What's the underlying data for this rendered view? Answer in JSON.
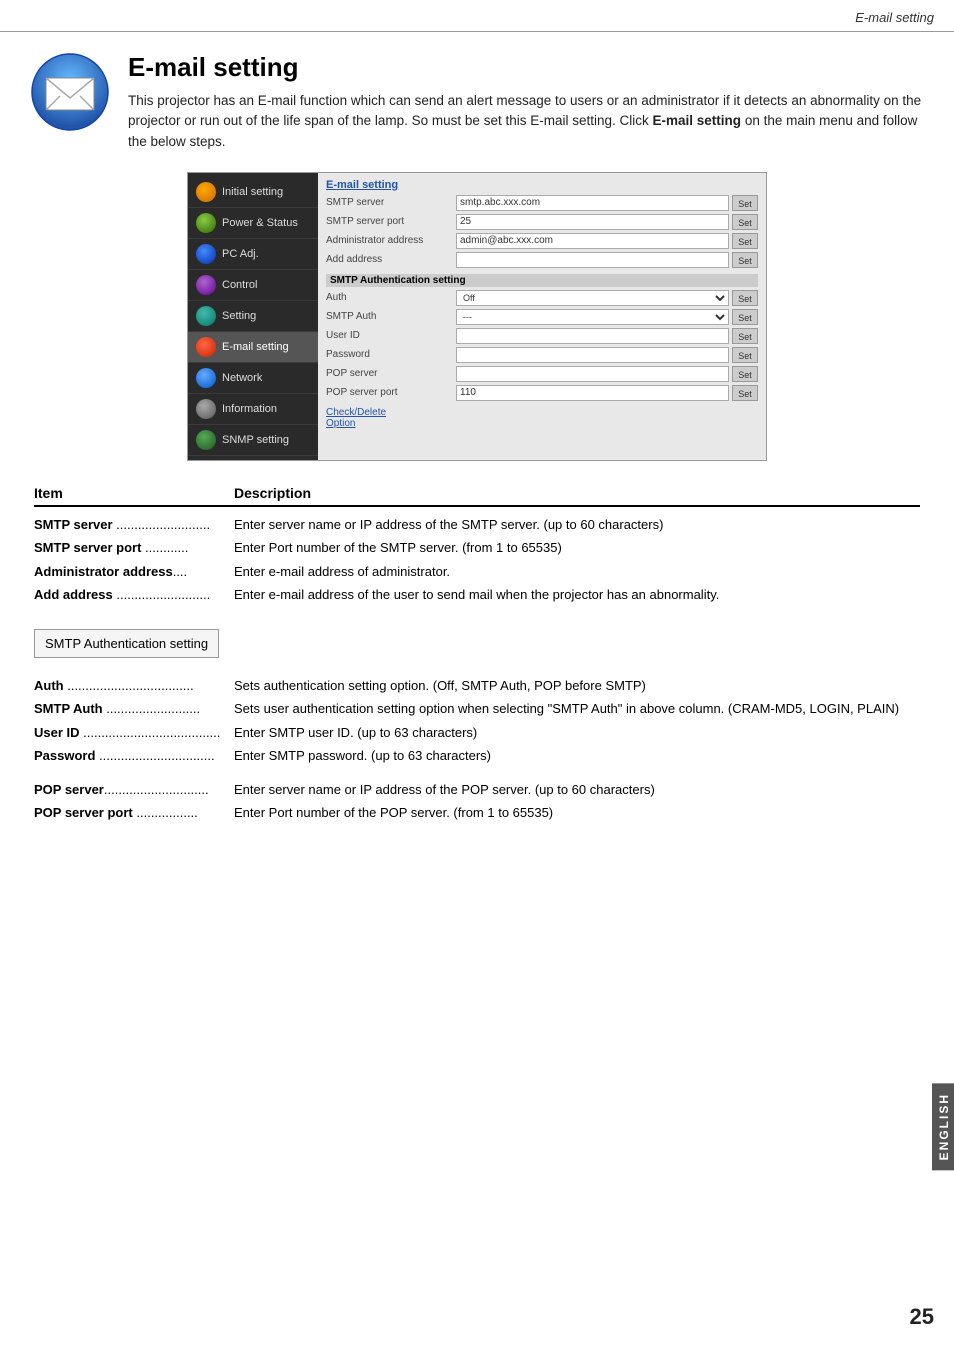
{
  "page": {
    "header": "E-mail setting",
    "page_number": "25",
    "english_tab": "ENGLISH"
  },
  "title_section": {
    "heading": "E-mail setting",
    "description": "This projector has an E-mail function which can send an alert message to users or an administrator if it detects an abnormality on the projector or run out of the life span of the lamp. So must be set this E-mail setting.",
    "click_text": "Click",
    "bold_part": "E-mail setting",
    "end_text": "on the main menu and follow the below steps."
  },
  "ui_panel": {
    "sidebar_items": [
      {
        "label": "Initial setting",
        "icon_class": "orange"
      },
      {
        "label": "Power & Status",
        "icon_class": "green"
      },
      {
        "label": "PC Adj.",
        "icon_class": "blue"
      },
      {
        "label": "Control",
        "icon_class": "purple"
      },
      {
        "label": "Setting",
        "icon_class": "teal"
      },
      {
        "label": "E-mail setting",
        "icon_class": "red",
        "active": true
      },
      {
        "label": "Network",
        "icon_class": "lightblue"
      },
      {
        "label": "Information",
        "icon_class": "gray"
      },
      {
        "label": "SNMP setting",
        "icon_class": "darkgreen"
      }
    ],
    "main": {
      "section_title": "E-mail setting",
      "fields": [
        {
          "label": "SMTP server",
          "value": "smtp.abc.xxx.com",
          "btn": "Set"
        },
        {
          "label": "SMTP server port",
          "value": "25",
          "btn": "Set"
        },
        {
          "label": "Administrator address",
          "value": "admin@abc.xxx.com",
          "btn": "Set"
        },
        {
          "label": "Add address",
          "value": "",
          "btn": "Set"
        }
      ],
      "smtp_auth": {
        "title": "SMTP Authentication setting",
        "fields": [
          {
            "label": "Auth",
            "value": "Off",
            "type": "select",
            "btn": "Set"
          },
          {
            "label": "SMTP Auth",
            "value": "---",
            "type": "select",
            "btn": "Set"
          },
          {
            "label": "User ID",
            "value": "",
            "btn": "Set"
          },
          {
            "label": "Password",
            "value": "",
            "btn": "Set"
          },
          {
            "label": "POP server",
            "value": "",
            "btn": "Set"
          },
          {
            "label": "POP server port",
            "value": "110",
            "btn": "Set"
          }
        ]
      },
      "bottom_links": [
        "Check/Delete",
        "Option"
      ]
    }
  },
  "description": {
    "col_item": "Item",
    "col_description": "Description",
    "rows": [
      {
        "item": "SMTP server",
        "dots": true,
        "desc": "Enter server name or IP address of the SMTP server. (up to 60 characters)"
      },
      {
        "item": "SMTP server port",
        "dots": true,
        "desc": "Enter Port number of the SMTP server. (from 1 to 65535)"
      },
      {
        "item": "Administrator address",
        "dots": true,
        "desc": "Enter e-mail address of administrator."
      },
      {
        "item": "Add address",
        "dots": true,
        "desc": "Enter e-mail address of the user to send mail when the projector has an abnormality."
      }
    ],
    "auth_box_label": "SMTP Authentication setting",
    "auth_rows": [
      {
        "item": "Auth",
        "dots": true,
        "desc": "Sets authentication setting option. (Off, SMTP Auth, POP before SMTP)"
      },
      {
        "item": "SMTP Auth",
        "dots": true,
        "desc": "Sets user authentication setting option when selecting \"SMTP Auth\" in above column. (CRAM-MD5, LOGIN, PLAIN)"
      },
      {
        "item": "User ID",
        "dots": true,
        "desc": "Enter SMTP user ID. (up to 63 characters)"
      },
      {
        "item": "Password",
        "dots": true,
        "desc": "Enter SMTP password. (up to 63 characters)"
      }
    ],
    "pop_rows": [
      {
        "item": "POP server",
        "dots": true,
        "desc": "Enter server name or IP address of the POP server. (up to 60 characters)"
      },
      {
        "item": "POP server port",
        "dots": true,
        "desc": "Enter Port number of the POP server. (from 1 to 65535)"
      }
    ]
  }
}
